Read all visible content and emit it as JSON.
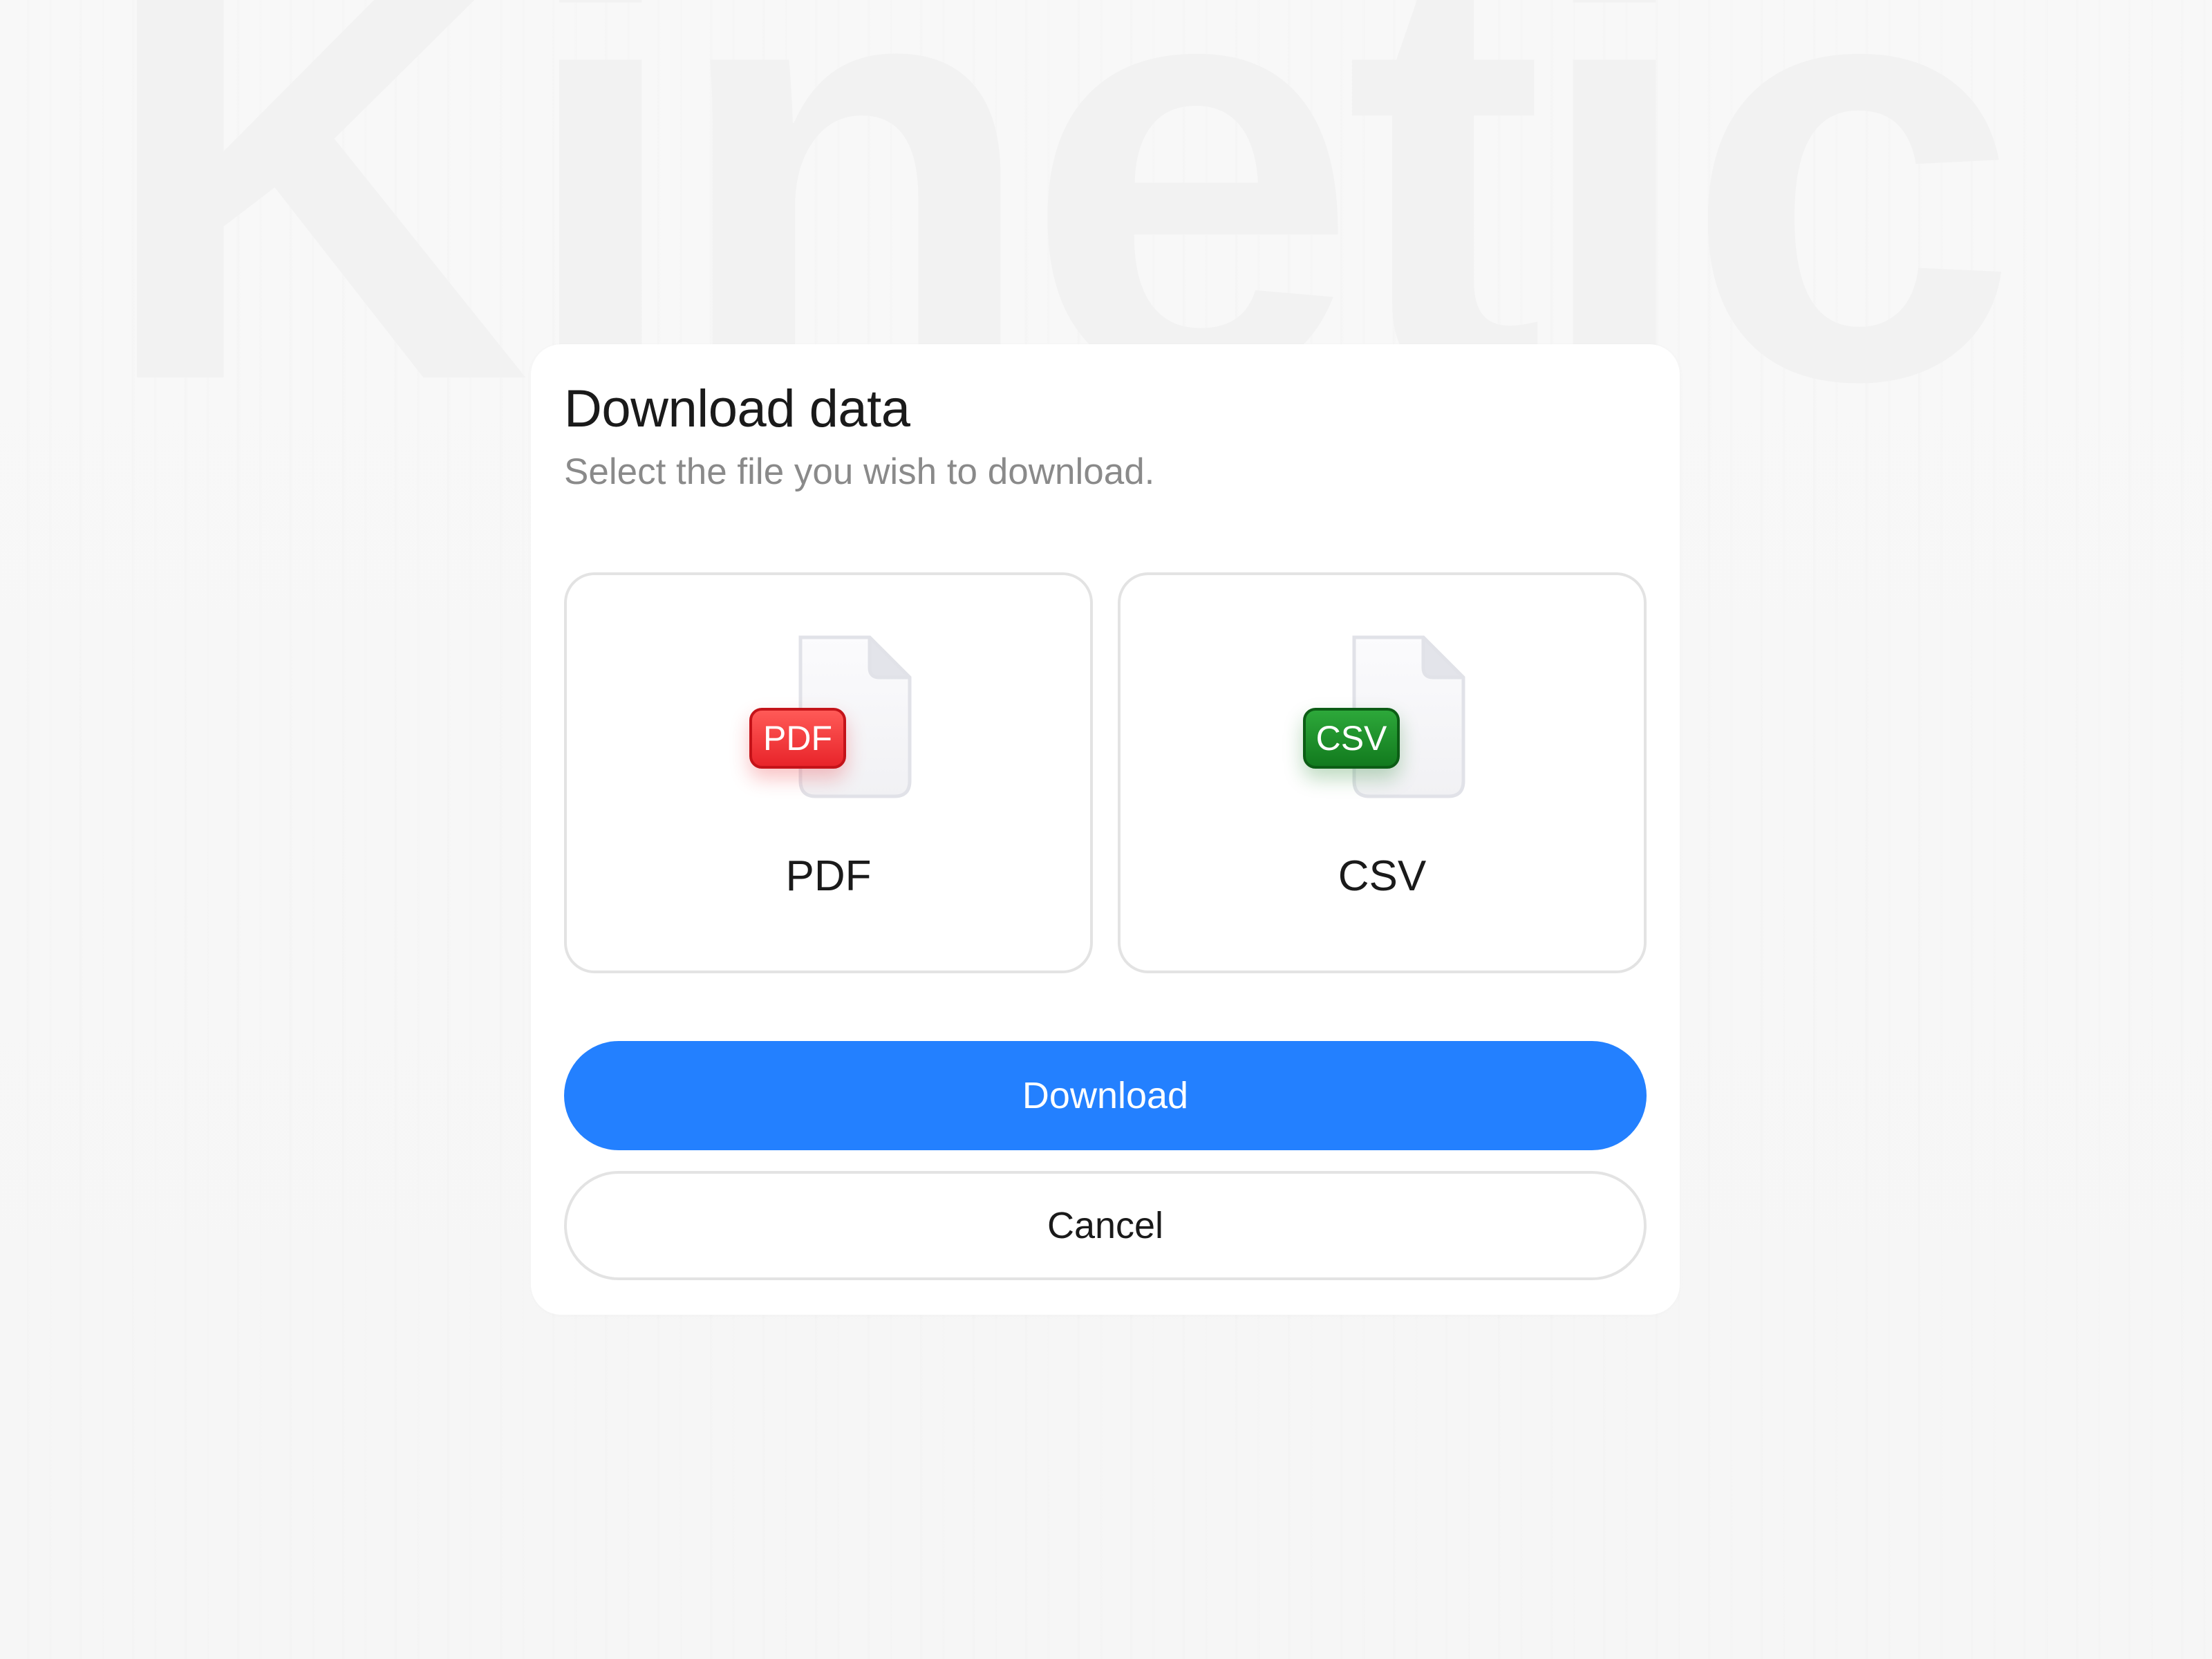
{
  "background": {
    "watermark_text": "Kinetic"
  },
  "dialog": {
    "title": "Download data",
    "subtitle": "Select the file you wish to download.",
    "options": [
      {
        "id": "pdf",
        "label": "PDF",
        "badge": "PDF",
        "badge_color": "#e8242a",
        "icon": "pdf-file-icon"
      },
      {
        "id": "csv",
        "label": "CSV",
        "badge": "CSV",
        "badge_color": "#127a1e",
        "icon": "csv-file-icon"
      }
    ],
    "primary_button": {
      "label": "Download",
      "color": "#2380ff"
    },
    "secondary_button": {
      "label": "Cancel"
    }
  }
}
